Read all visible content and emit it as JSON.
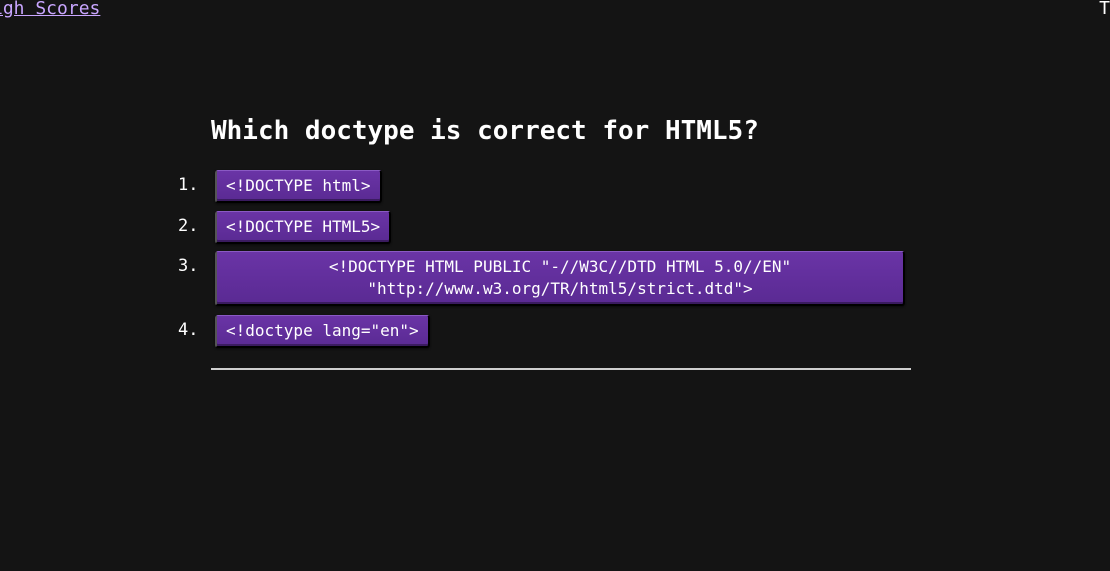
{
  "header": {
    "high_scores_link": "igh Scores",
    "right_fragment": "T"
  },
  "quiz": {
    "question": "Which doctype is correct for HTML5?",
    "answers": [
      {
        "number": "1.",
        "label": "<!DOCTYPE html>"
      },
      {
        "number": "2.",
        "label": "<!DOCTYPE HTML5>"
      },
      {
        "number": "3.",
        "label": "<!DOCTYPE HTML PUBLIC \"-//W3C//DTD HTML 5.0//EN\" \"http://www.w3.org/TR/html5/strict.dtd\">"
      },
      {
        "number": "4.",
        "label": "<!doctype lang=\"en\">"
      }
    ]
  },
  "colors": {
    "background": "#141414",
    "button": "#5f2d9a",
    "link": "#c9a6ff",
    "text": "#ffffff"
  }
}
